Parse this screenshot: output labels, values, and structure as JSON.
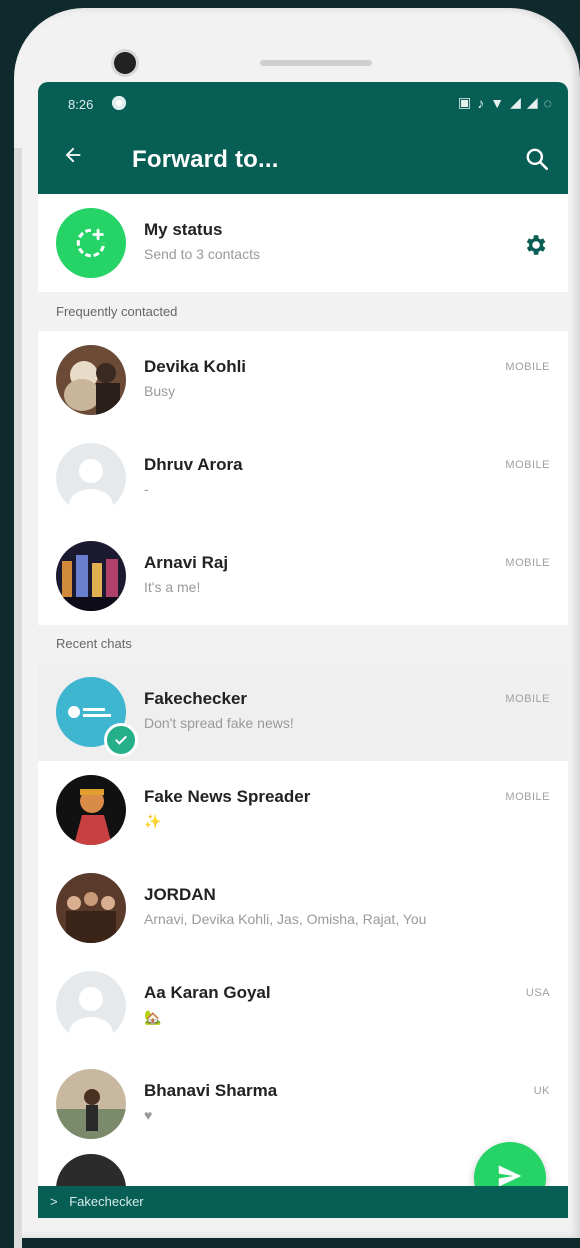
{
  "statusbar": {
    "time": "8:26"
  },
  "header": {
    "title": "Forward to..."
  },
  "my_status": {
    "name": "My status",
    "subtitle": "Send to 3 contacts"
  },
  "sections": {
    "frequent": "Frequently contacted",
    "recent": "Recent chats"
  },
  "frequent": [
    {
      "name": "Devika Kohli",
      "subtitle": "Busy",
      "tag": "MOBILE"
    },
    {
      "name": "Dhruv Arora",
      "subtitle": "-",
      "tag": "MOBILE"
    },
    {
      "name": "Arnavi Raj",
      "subtitle": "It's a me!",
      "tag": "MOBILE"
    }
  ],
  "recent": [
    {
      "name": "Fakechecker",
      "subtitle": "Don't spread fake news!",
      "tag": "MOBILE",
      "selected": true
    },
    {
      "name": "Fake News Spreader",
      "subtitle": "✨",
      "tag": "MOBILE"
    },
    {
      "name": "JORDAN",
      "subtitle": "Arnavi, Devika Kohli, Jas, Omisha, Rajat, You",
      "tag": ""
    },
    {
      "name": "Aa Karan Goyal",
      "subtitle": "🏡",
      "tag": "USA"
    },
    {
      "name": "Bhanavi Sharma",
      "subtitle": "♥",
      "tag": "UK"
    }
  ],
  "selection_bar": {
    "arrow": ">",
    "label": "Fakechecker"
  },
  "colors": {
    "header": "#075e54",
    "accent": "#25d366",
    "badge": "#25b08a"
  },
  "icons": {
    "back": "back-arrow-icon",
    "search": "search-icon",
    "gear": "gear-icon",
    "send": "send-icon",
    "status": "status-add-icon"
  }
}
